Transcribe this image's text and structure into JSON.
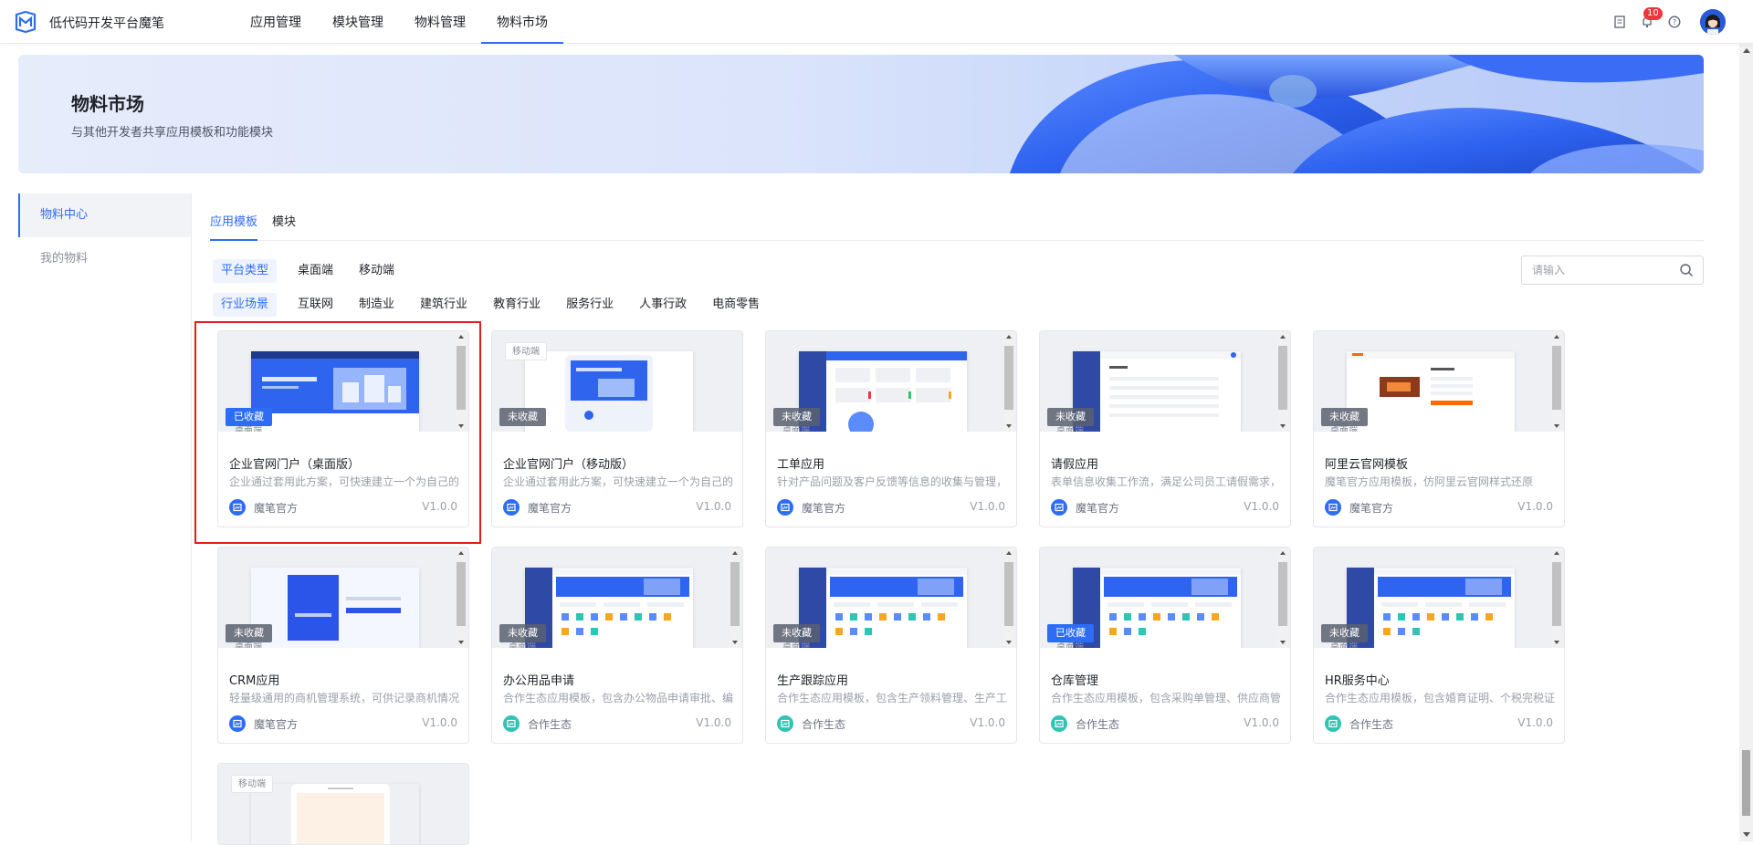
{
  "header": {
    "app_name": "低代码开发平台魔笔",
    "nav": [
      {
        "label": "应用管理",
        "active": false
      },
      {
        "label": "模块管理",
        "active": false
      },
      {
        "label": "物料管理",
        "active": false
      },
      {
        "label": "物料市场",
        "active": true
      }
    ],
    "notification_count": "10",
    "icons": [
      "doc-icon",
      "bell-icon",
      "help-icon",
      "avatar"
    ]
  },
  "banner": {
    "title": "物料市场",
    "subtitle": "与其他开发者共享应用模板和功能模块"
  },
  "side": {
    "items": [
      {
        "label": "物料中心",
        "active": true
      },
      {
        "label": "我的物料",
        "active": false
      }
    ]
  },
  "tabs": [
    {
      "label": "应用模板",
      "active": true
    },
    {
      "label": "模块",
      "active": false
    }
  ],
  "filters": {
    "platform": {
      "head": "平台类型",
      "options": [
        "桌面端",
        "移动端"
      ]
    },
    "industry": {
      "head": "行业场景",
      "options": [
        "互联网",
        "制造业",
        "建筑行业",
        "教育行业",
        "服务行业",
        "人事行政",
        "电商零售"
      ]
    }
  },
  "search": {
    "placeholder": "请输入"
  },
  "cards": [
    {
      "title": "企业官网门户（桌面版）",
      "desc": "企业通过套用此方案，可快速建立一个为自己的",
      "author": "魔笔官方",
      "version": "V1.0.0",
      "fav": "已收藏",
      "fav_on": true,
      "ghost": "桌面端",
      "tag": "",
      "author_type": "official",
      "thumb": "portal"
    },
    {
      "title": "企业官网门户（移动版）",
      "desc": "企业通过套用此方案，可快速建立一个为自己的",
      "author": "魔笔官方",
      "version": "V1.0.0",
      "fav": "未收藏",
      "fav_on": false,
      "ghost": "",
      "tag": "移动端",
      "author_type": "official",
      "thumb": "mobile-portal"
    },
    {
      "title": "工单应用",
      "desc": "针对产品问题及客户反馈等信息的收集与管理，",
      "author": "魔笔官方",
      "version": "V1.0.0",
      "fav": "未收藏",
      "fav_on": false,
      "ghost": "桌面端",
      "tag": "",
      "author_type": "official",
      "thumb": "admin"
    },
    {
      "title": "请假应用",
      "desc": "表单信息收集工作流，满足公司员工请假需求，",
      "author": "魔笔官方",
      "version": "V1.0.0",
      "fav": "未收藏",
      "fav_on": false,
      "ghost": "桌面端",
      "tag": "",
      "author_type": "official",
      "thumb": "form"
    },
    {
      "title": "阿里云官网模板",
      "desc": "魔笔官方应用模板，仿阿里云官网样式还原",
      "author": "魔笔官方",
      "version": "V1.0.0",
      "fav": "未收藏",
      "fav_on": false,
      "ghost": "桌面端",
      "tag": "",
      "author_type": "official",
      "thumb": "aliyun"
    },
    {
      "title": "CRM应用",
      "desc": "轻量级通用的商机管理系统，可供记录商机情况",
      "author": "魔笔官方",
      "version": "V1.0.0",
      "fav": "未收藏",
      "fav_on": false,
      "ghost": "桌面端",
      "tag": "",
      "author_type": "official",
      "thumb": "crm"
    },
    {
      "title": "办公用品申请",
      "desc": "合作生态应用模板，包含办公物品申请审批、编",
      "author": "合作生态",
      "version": "V1.0.0",
      "fav": "未收藏",
      "fav_on": false,
      "ghost": "桌面端",
      "tag": "",
      "author_type": "eco",
      "thumb": "dash"
    },
    {
      "title": "生产跟踪应用",
      "desc": "合作生态应用模板，包含生产领料管理、生产工",
      "author": "合作生态",
      "version": "V1.0.0",
      "fav": "未收藏",
      "fav_on": false,
      "ghost": "桌面端",
      "tag": "",
      "author_type": "eco",
      "thumb": "dash"
    },
    {
      "title": "仓库管理",
      "desc": "合作生态应用模板，包含采购单管理、供应商管",
      "author": "合作生态",
      "version": "V1.0.0",
      "fav": "已收藏",
      "fav_on": true,
      "ghost": "桌面端",
      "tag": "",
      "author_type": "eco",
      "thumb": "dash"
    },
    {
      "title": "HR服务中心",
      "desc": "合作生态应用模板，包含婚育证明、个税完税证",
      "author": "合作生态",
      "version": "V1.0.0",
      "fav": "未收藏",
      "fav_on": false,
      "ghost": "桌面端",
      "tag": "",
      "author_type": "eco",
      "thumb": "dash"
    },
    {
      "title": "",
      "desc": "",
      "author": "",
      "version": "",
      "fav": "",
      "fav_on": false,
      "ghost": "",
      "tag": "移动端",
      "author_type": "",
      "thumb": "mobile"
    }
  ]
}
